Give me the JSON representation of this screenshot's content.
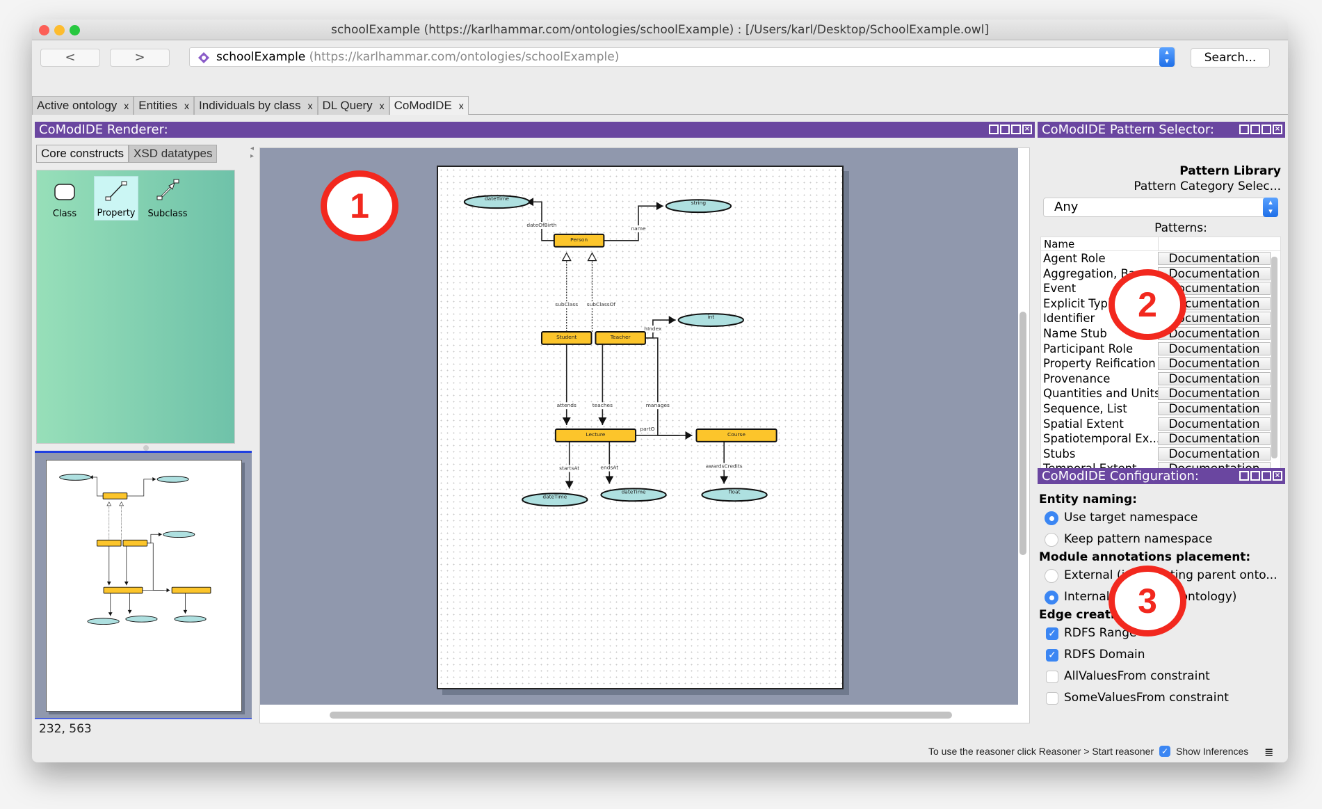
{
  "window": {
    "title": "schoolExample (https://karlhammar.com/ontologies/schoolExample)  : [/Users/karl/Desktop/SchoolExample.owl]"
  },
  "toolbar": {
    "back_label": "<",
    "forward_label": ">",
    "ontology_name": "schoolExample",
    "ontology_iri": "(https://karlhammar.com/ontologies/schoolExample)",
    "search_label": "Search..."
  },
  "tabs": [
    {
      "label": "Active ontology",
      "close": "x"
    },
    {
      "label": "Entities",
      "close": "x"
    },
    {
      "label": "Individuals by class",
      "close": "x"
    },
    {
      "label": "DL Query",
      "close": "x"
    },
    {
      "label": "CoModIDE",
      "close": "x",
      "active": true
    }
  ],
  "renderer": {
    "title": "CoModIDE Renderer:",
    "palette_tabs": [
      "Core constructs",
      "XSD datatypes"
    ],
    "palette_items": [
      {
        "label": "Class",
        "icon": "class-shape-icon"
      },
      {
        "label": "Property",
        "icon": "property-edge-icon",
        "selected": true
      },
      {
        "label": "Subclass",
        "icon": "subclass-arrow-icon"
      }
    ],
    "cursor_coords": "232, 563"
  },
  "diagram": {
    "classes": [
      "Person",
      "Student",
      "Teacher",
      "Lecture",
      "Course"
    ],
    "datatypes": [
      "dateTime",
      "string",
      "int",
      "dateTime",
      "dateTime",
      "float"
    ],
    "edges": [
      {
        "label": "dateOfBirth",
        "from": "Person",
        "to": "dateTime"
      },
      {
        "label": "name",
        "from": "Person",
        "to": "string"
      },
      {
        "label": "subClass",
        "from": "Student",
        "to": "Person",
        "kind": "subclass"
      },
      {
        "label": "subClassOf",
        "from": "Teacher",
        "to": "Person",
        "kind": "subclass"
      },
      {
        "label": "hIndex",
        "from": "Teacher",
        "to": "int"
      },
      {
        "label": "attends",
        "from": "Student",
        "to": "Lecture"
      },
      {
        "label": "teaches",
        "from": "Teacher",
        "to": "Lecture"
      },
      {
        "label": "manages",
        "from": "Teacher",
        "to": "Course"
      },
      {
        "label": "partO",
        "from": "Lecture",
        "to": "Course"
      },
      {
        "label": "startsAt",
        "from": "Lecture",
        "to": "dateTime"
      },
      {
        "label": "endsAt",
        "from": "Lecture",
        "to": "dateTime"
      },
      {
        "label": "awardsCredits",
        "from": "Course",
        "to": "float"
      }
    ]
  },
  "pattern_selector": {
    "title": "CoModIDE Pattern Selector:",
    "library_label": "Pattern Library",
    "category_label": "Pattern Category Selec...",
    "category_value": "Any",
    "patterns_label": "Patterns:",
    "column_name": "Name",
    "doc_label": "Documentation",
    "patterns": [
      "Agent Role",
      "Aggregation, Bag, ...",
      "Event",
      "Explicit Typing",
      "Identifier",
      "Name Stub",
      "Participant Role",
      "Property Reification",
      "Provenance",
      "Quantities and Units",
      "Sequence, List",
      "Spatial Extent",
      "Spatiotemporal Ex...",
      "Stubs",
      "Temporal Extent"
    ]
  },
  "configuration": {
    "title": "CoModIDE Configuration:",
    "entity_naming_label": "Entity naming:",
    "entity_naming_options": [
      {
        "label": "Use target namespace",
        "selected": true
      },
      {
        "label": "Keep pattern namespace",
        "selected": false
      }
    ],
    "module_label": "Module annotations placement:",
    "module_options": [
      {
        "label": "External (in importing parent onto...",
        "selected": false
      },
      {
        "label": "Internal (in module ontology)",
        "selected": true
      }
    ],
    "edge_label": "Edge creation:",
    "edge_options": [
      {
        "label": "RDFS Range",
        "checked": true
      },
      {
        "label": "RDFS Domain",
        "checked": true
      },
      {
        "label": "AllValuesFrom constraint",
        "checked": false
      },
      {
        "label": "SomeValuesFrom constraint",
        "checked": false
      }
    ]
  },
  "annotations": [
    "1",
    "2",
    "3"
  ],
  "statusbar": {
    "reasoner_hint": "To use the reasoner click Reasoner > Start reasoner",
    "show_inferences_label": "Show Inferences",
    "show_inferences_checked": true
  },
  "colors": {
    "view_header": "#6a46a0",
    "class_fill": "#fcc52b",
    "datatype_fill": "#aee0e0",
    "canvas_bg": "#9098ad",
    "annotation_red": "#f2281e",
    "accent_blue": "#3b86f3"
  }
}
